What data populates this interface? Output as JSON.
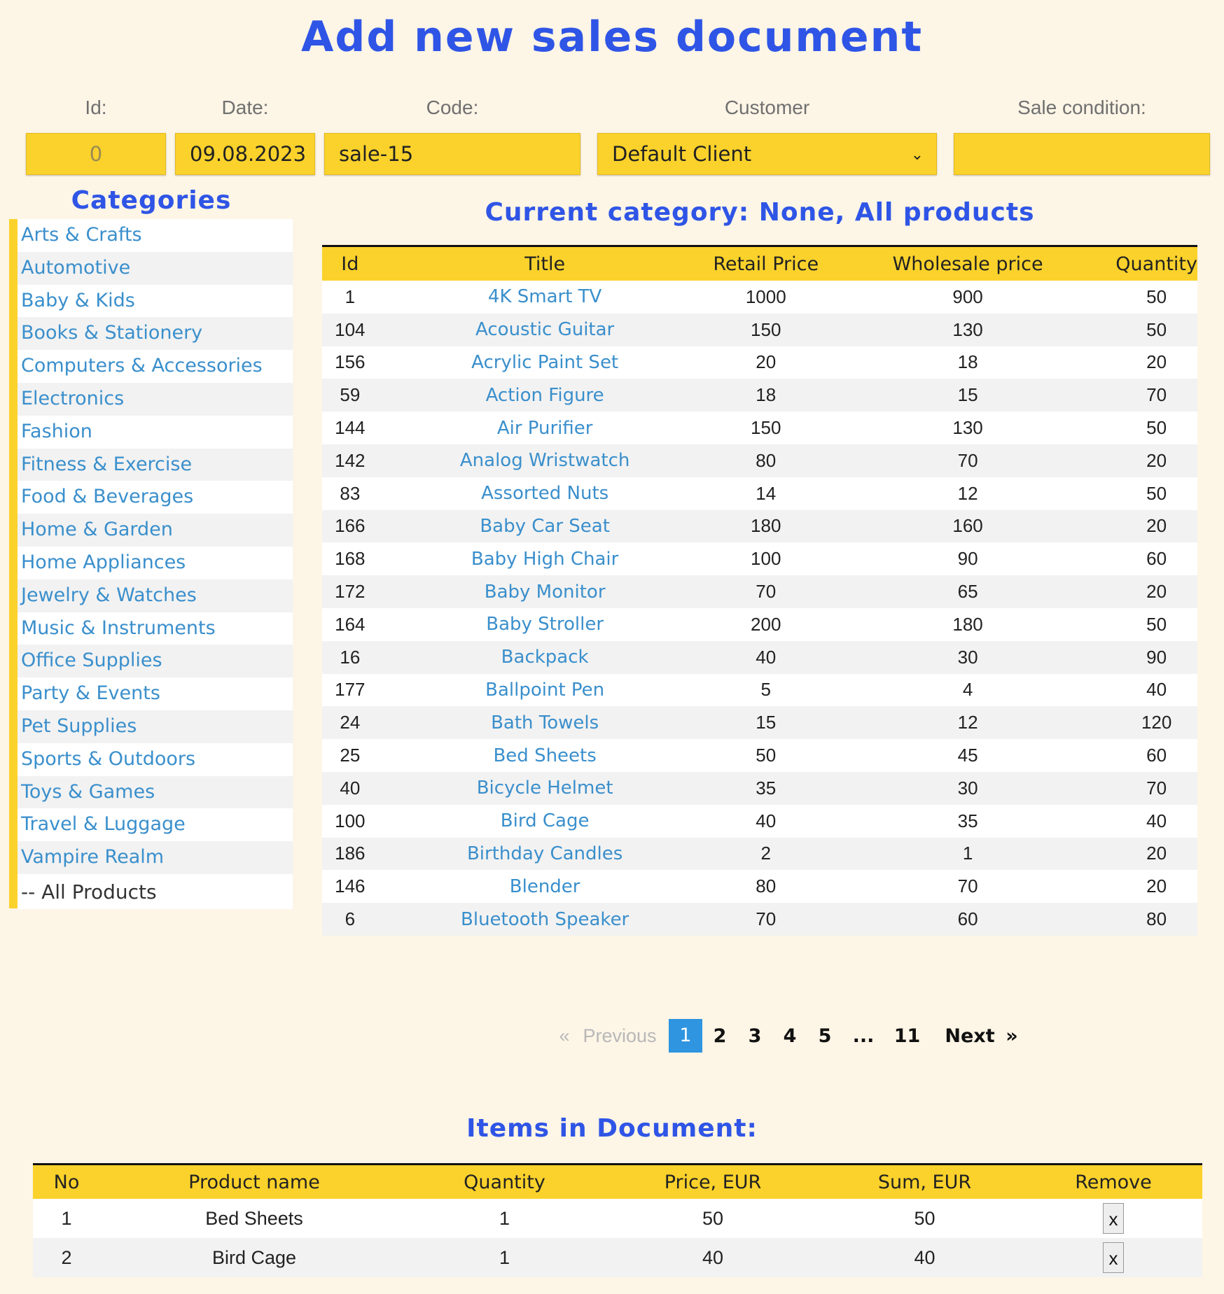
{
  "page": {
    "title": "Add new sales document"
  },
  "form": {
    "id_label": "Id:",
    "id_value": "0",
    "date_label": "Date:",
    "date_value": "09.08.2023",
    "code_label": "Code:",
    "code_value": "sale-15",
    "customer_label": "Customer",
    "customer_value": "Default Client",
    "sale_condition_label": "Sale condition:",
    "sale_condition_value": ""
  },
  "categories": {
    "title": "Categories",
    "items": [
      "Arts & Crafts",
      "Automotive",
      "Baby & Kids",
      "Books & Stationery",
      "Computers & Accessories",
      "Electronics",
      "Fashion",
      "Fitness & Exercise",
      "Food & Beverages",
      "Home & Garden",
      "Home Appliances",
      "Jewelry & Watches",
      "Music & Instruments",
      "Office Supplies",
      "Party & Events",
      "Pet Supplies",
      "Sports & Outdoors",
      "Toys & Games",
      "Travel & Luggage",
      "Vampire Realm"
    ],
    "all_label": "-- All Products"
  },
  "products": {
    "title": "Current category: None, All products",
    "columns": [
      "Id",
      "Title",
      "Retail Price",
      "Wholesale price",
      "Quantity"
    ],
    "rows": [
      [
        "1",
        "4K Smart TV",
        "1000",
        "900",
        "50"
      ],
      [
        "104",
        "Acoustic Guitar",
        "150",
        "130",
        "50"
      ],
      [
        "156",
        "Acrylic Paint Set",
        "20",
        "18",
        "20"
      ],
      [
        "59",
        "Action Figure",
        "18",
        "15",
        "70"
      ],
      [
        "144",
        "Air Purifier",
        "150",
        "130",
        "50"
      ],
      [
        "142",
        "Analog Wristwatch",
        "80",
        "70",
        "20"
      ],
      [
        "83",
        "Assorted Nuts",
        "14",
        "12",
        "50"
      ],
      [
        "166",
        "Baby Car Seat",
        "180",
        "160",
        "20"
      ],
      [
        "168",
        "Baby High Chair",
        "100",
        "90",
        "60"
      ],
      [
        "172",
        "Baby Monitor",
        "70",
        "65",
        "20"
      ],
      [
        "164",
        "Baby Stroller",
        "200",
        "180",
        "50"
      ],
      [
        "16",
        "Backpack",
        "40",
        "30",
        "90"
      ],
      [
        "177",
        "Ballpoint Pen",
        "5",
        "4",
        "40"
      ],
      [
        "24",
        "Bath Towels",
        "15",
        "12",
        "120"
      ],
      [
        "25",
        "Bed Sheets",
        "50",
        "45",
        "60"
      ],
      [
        "40",
        "Bicycle Helmet",
        "35",
        "30",
        "70"
      ],
      [
        "100",
        "Bird Cage",
        "40",
        "35",
        "40"
      ],
      [
        "186",
        "Birthday Candles",
        "2",
        "1",
        "20"
      ],
      [
        "146",
        "Blender",
        "80",
        "70",
        "20"
      ],
      [
        "6",
        "Bluetooth Speaker",
        "70",
        "60",
        "80"
      ]
    ]
  },
  "pagination": {
    "prev_arrow": "«",
    "prev_label": "Previous",
    "pages": [
      "1",
      "2",
      "3",
      "4",
      "5",
      "...",
      "11"
    ],
    "active_page": "1",
    "next_label": "Next",
    "next_arrow": "»"
  },
  "document": {
    "title": "Items in Document:",
    "columns": [
      "No",
      "Product name",
      "Quantity",
      "Price, EUR",
      "Sum, EUR",
      "Remove"
    ],
    "rows": [
      [
        "1",
        "Bed Sheets",
        "1",
        "50",
        "50",
        "x"
      ],
      [
        "2",
        "Bird Cage",
        "1",
        "40",
        "40",
        "x"
      ]
    ]
  }
}
